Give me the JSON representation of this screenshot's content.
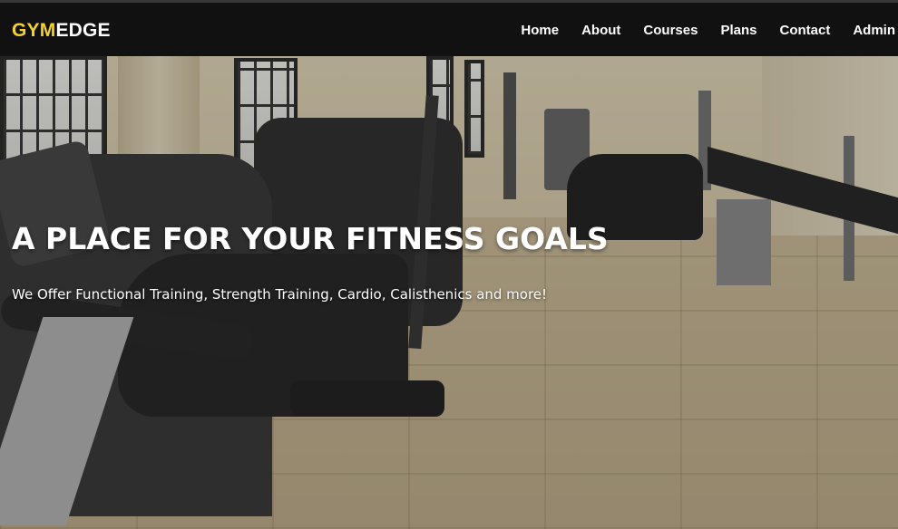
{
  "navbar": {
    "brand_primary": "GYM",
    "brand_secondary": "EDGE",
    "items": [
      {
        "label": "Home"
      },
      {
        "label": "About"
      },
      {
        "label": "Courses"
      },
      {
        "label": "Plans"
      },
      {
        "label": "Contact"
      },
      {
        "label": "Admin"
      }
    ]
  },
  "hero": {
    "title": "A PLACE FOR YOUR FITNESS GOALS",
    "subtitle": "We Offer Functional Training, Strength Training, Cardio, Calisthenics and more!",
    "background_image": "gym-interior-photo"
  },
  "colors": {
    "brand_accent": "#f2d22b",
    "navbar_bg": "#111111",
    "text": "#ffffff"
  }
}
